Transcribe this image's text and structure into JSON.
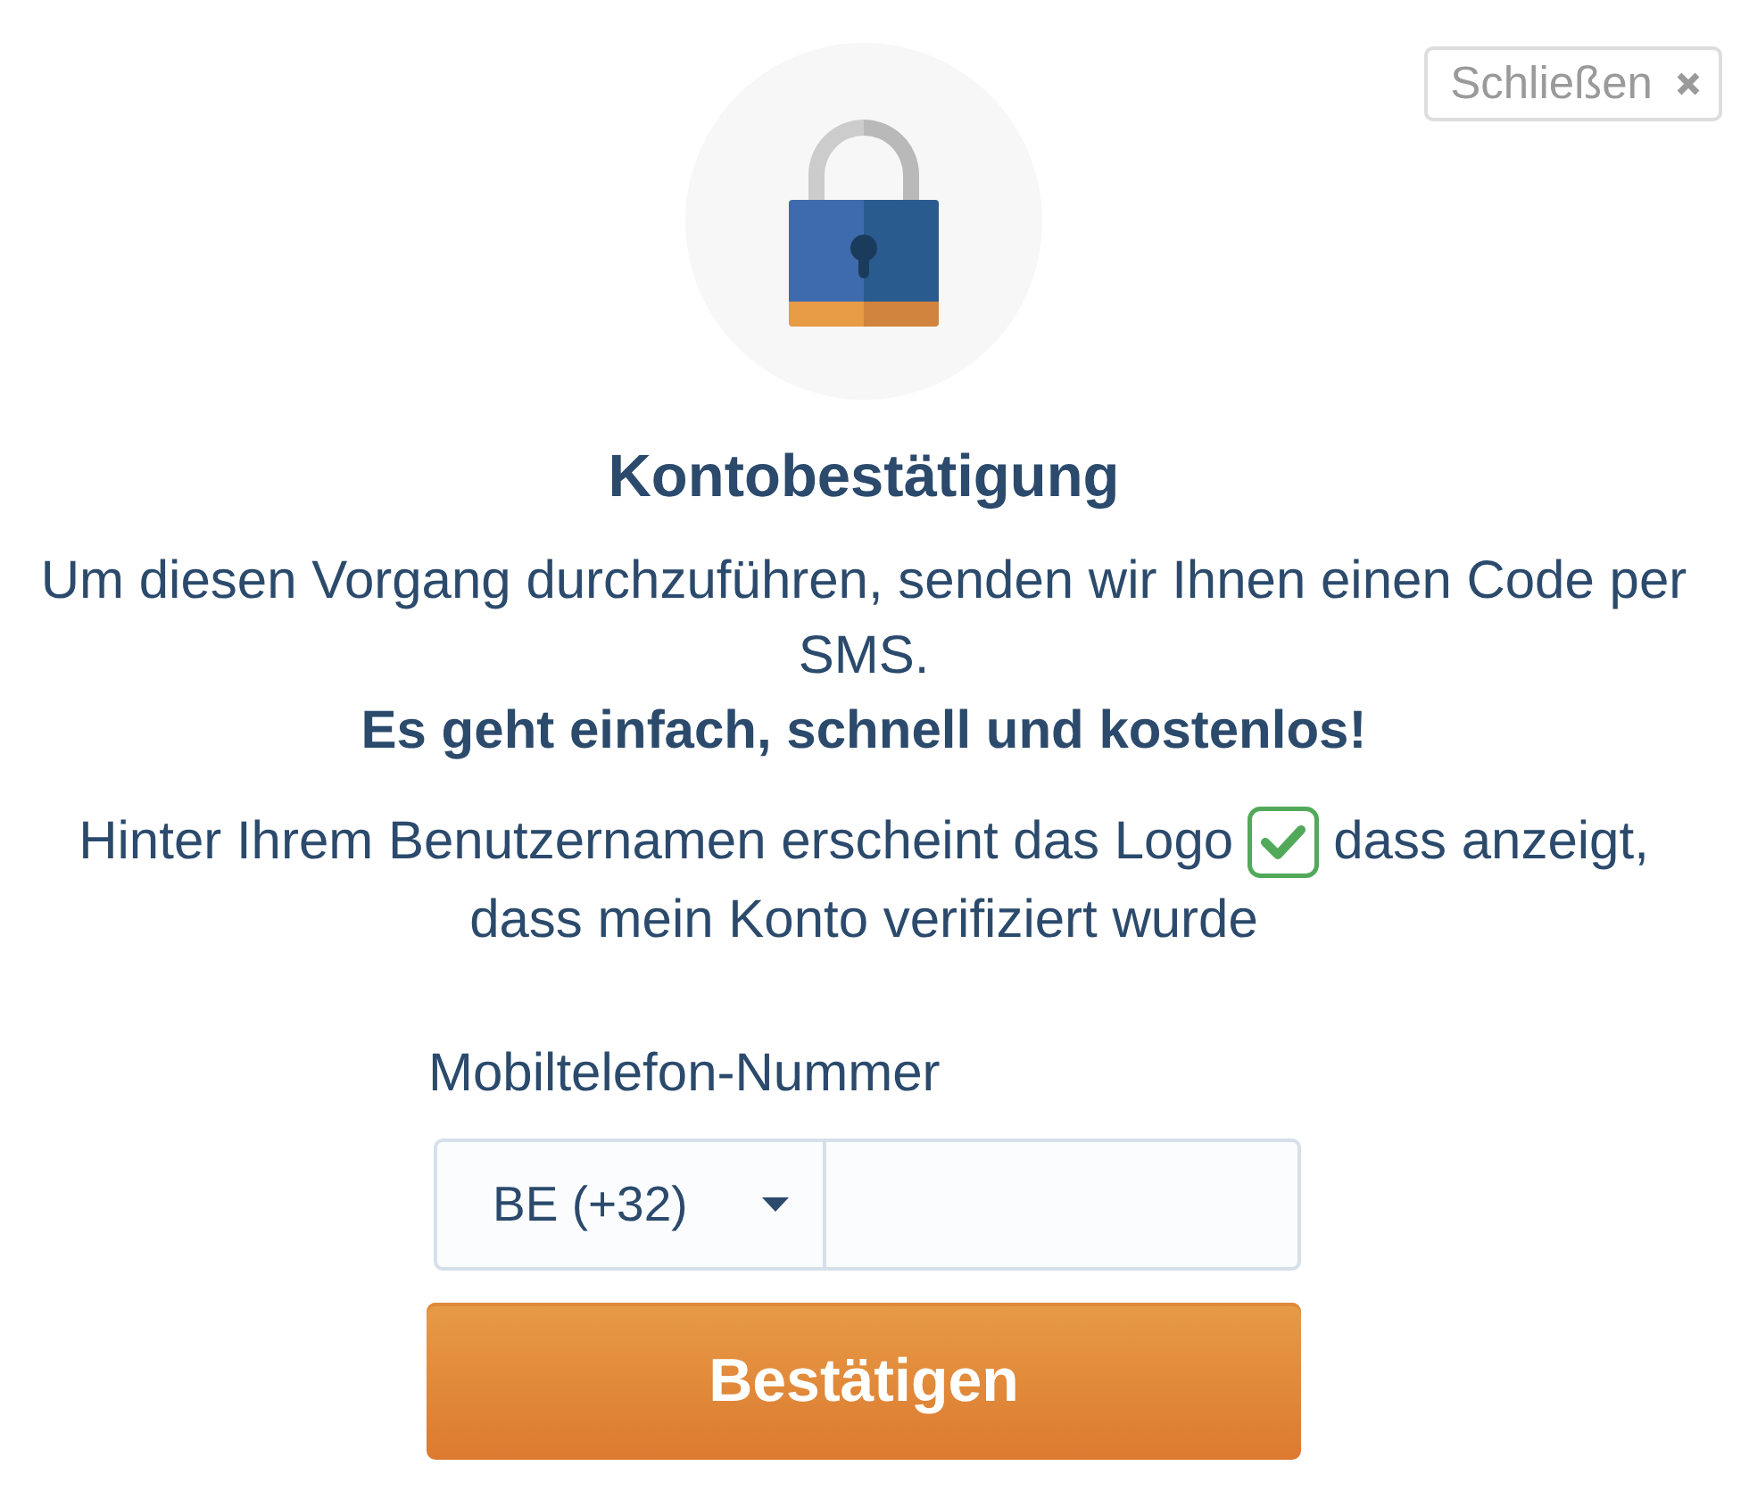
{
  "close_button": {
    "label": "Schließen"
  },
  "title": "Kontobestätigung",
  "intro": "Um diesen Vorgang durchzuführen, senden wir Ihnen einen Code per SMS.",
  "tagline": "Es geht einfach, schnell und kostenlos!",
  "notice": {
    "before_icon": "Hinter Ihrem Benutzernamen erscheint das Logo",
    "after_icon": "dass anzeigt,",
    "second_line": "dass mein Konto verifiziert wurde"
  },
  "phone": {
    "label": "Mobiltelefon-Nummer",
    "country": "BE (+32)"
  },
  "submit_button": {
    "label": "Bestätigen"
  }
}
